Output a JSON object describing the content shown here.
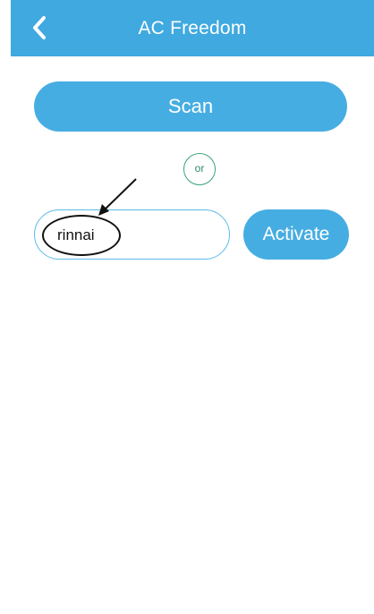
{
  "header": {
    "title": "AC Freedom",
    "back_icon": "chevron-left-icon",
    "background_color": "#3fa9e0"
  },
  "main": {
    "scan_label": "Scan",
    "divider_label": "or",
    "code_input_value": "rinnai",
    "activate_label": "Activate",
    "accent_color": "#46ade2",
    "divider_color": "#3aa478"
  },
  "annotation": {
    "type": "arrow-and-circle",
    "color": "#111111"
  }
}
